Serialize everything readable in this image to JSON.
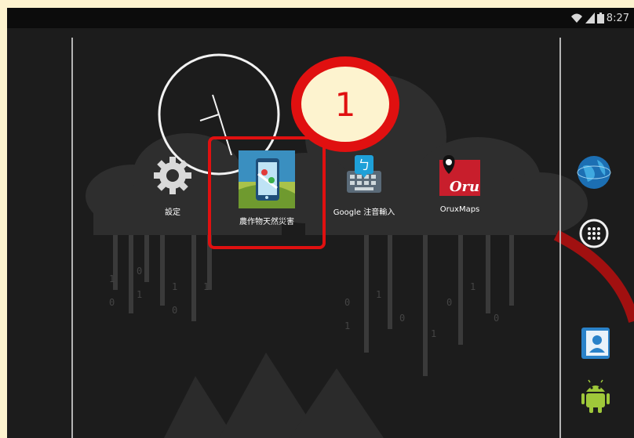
{
  "status_bar": {
    "time": "8:27"
  },
  "apps": [
    {
      "label": "設定",
      "icon": "gear-icon"
    },
    {
      "label": "農作物天然災害",
      "icon": "map-phone-icon"
    },
    {
      "label": "Google 注音輸入",
      "icon": "keyboard-icon"
    },
    {
      "label": "OruxMaps",
      "icon": "oruxmaps-icon",
      "icon_text": "Oru"
    }
  ],
  "annotation": {
    "step_number": "1"
  },
  "colors": {
    "highlight": "#e01010",
    "background": "#1c1c1c",
    "border": "#fdf3cf"
  },
  "dock": [
    "browser-globe-icon",
    "app-drawer-icon",
    "contacts-icon",
    "android-icon"
  ]
}
